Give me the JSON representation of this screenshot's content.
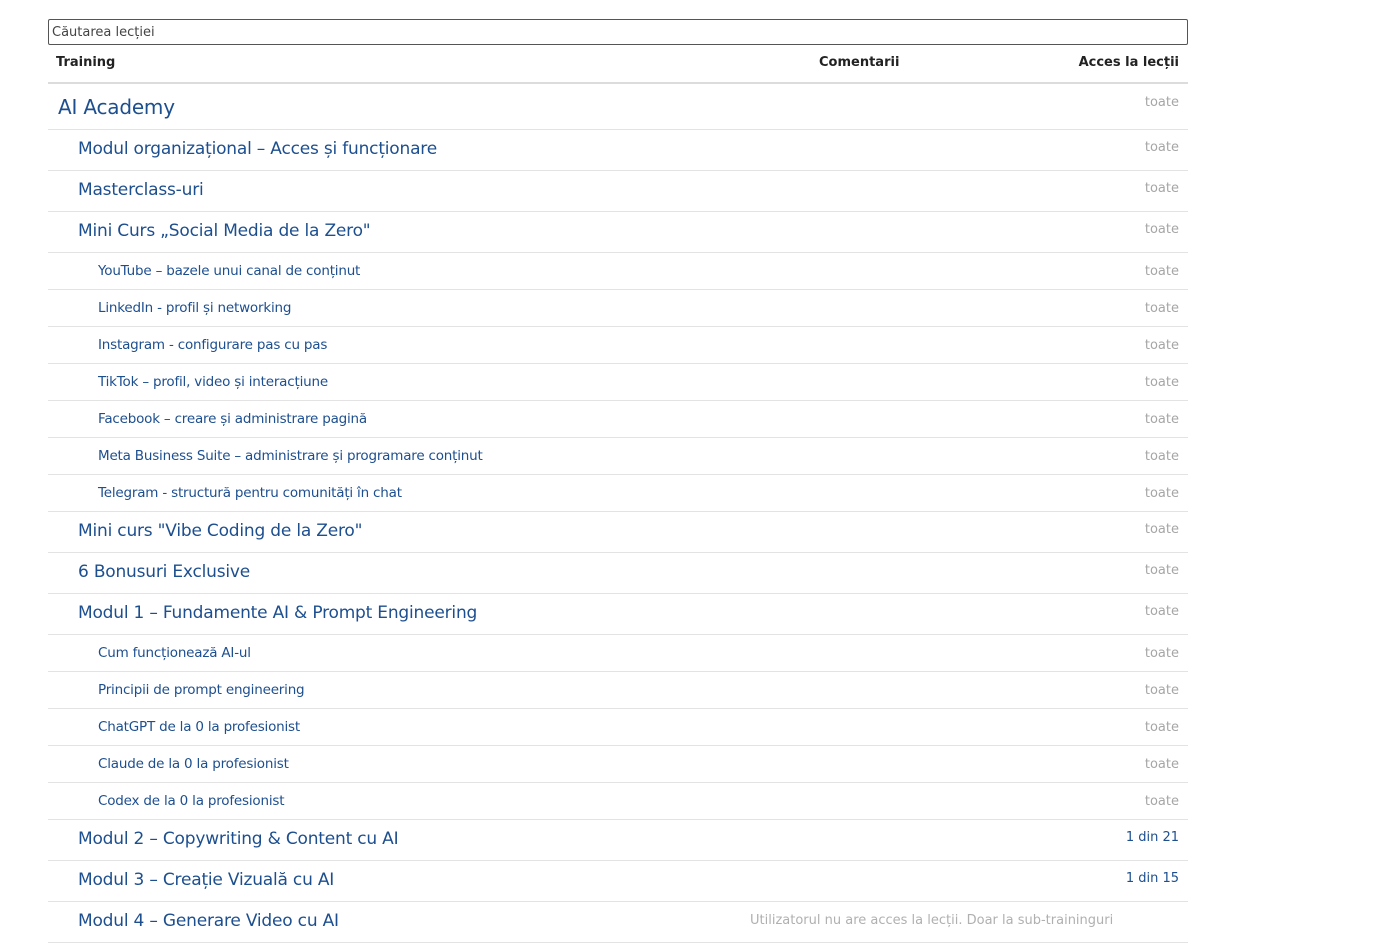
{
  "search": {
    "placeholder": "Căutarea lecției"
  },
  "header": {
    "training": "Training",
    "comments": "Comentarii",
    "access": "Acces la lecții"
  },
  "rows": [
    {
      "title": "AI Academy",
      "access": "toate"
    },
    {
      "title": "Modul organizațional – Acces și funcționare",
      "access": "toate"
    },
    {
      "title": "Masterclass-uri",
      "access": "toate"
    },
    {
      "title": "Mini Curs „Social Media de la Zero\"",
      "access": "toate"
    },
    {
      "title": "YouTube – bazele unui canal de conținut",
      "access": "toate"
    },
    {
      "title": "LinkedIn - profil și networking",
      "access": "toate"
    },
    {
      "title": "Instagram - configurare pas cu pas",
      "access": "toate"
    },
    {
      "title": "TikTok – profil, video și interacțiune",
      "access": "toate"
    },
    {
      "title": "Facebook – creare și administrare pagină",
      "access": "toate"
    },
    {
      "title": "Meta Business Suite – administrare și programare conținut",
      "access": "toate"
    },
    {
      "title": "Telegram - structură pentru comunități în chat",
      "access": "toate"
    },
    {
      "title": "Mini curs \"Vibe Coding de la Zero\"",
      "access": "toate"
    },
    {
      "title": "6 Bonusuri Exclusive",
      "access": "toate"
    },
    {
      "title": "Modul 1 – Fundamente AI & Prompt Engineering",
      "access": "toate"
    },
    {
      "title": "Cum funcționează AI-ul",
      "access": "toate"
    },
    {
      "title": "Principii de prompt engineering",
      "access": "toate"
    },
    {
      "title": "ChatGPT de la 0 la profesionist",
      "access": "toate"
    },
    {
      "title": "Claude de la 0 la profesionist",
      "access": "toate"
    },
    {
      "title": "Codex de la 0 la profesionist",
      "access": "toate"
    },
    {
      "title": "Modul 2 – Copywriting & Content cu AI",
      "access": "1 din 21"
    },
    {
      "title": "Modul 3 – Creație Vizuală cu AI",
      "access": "1 din 15"
    },
    {
      "title": "Modul 4 – Generare Video cu AI",
      "note": "Utilizatorul nu are acces la lecții. Doar la sub-traininguri"
    }
  ]
}
